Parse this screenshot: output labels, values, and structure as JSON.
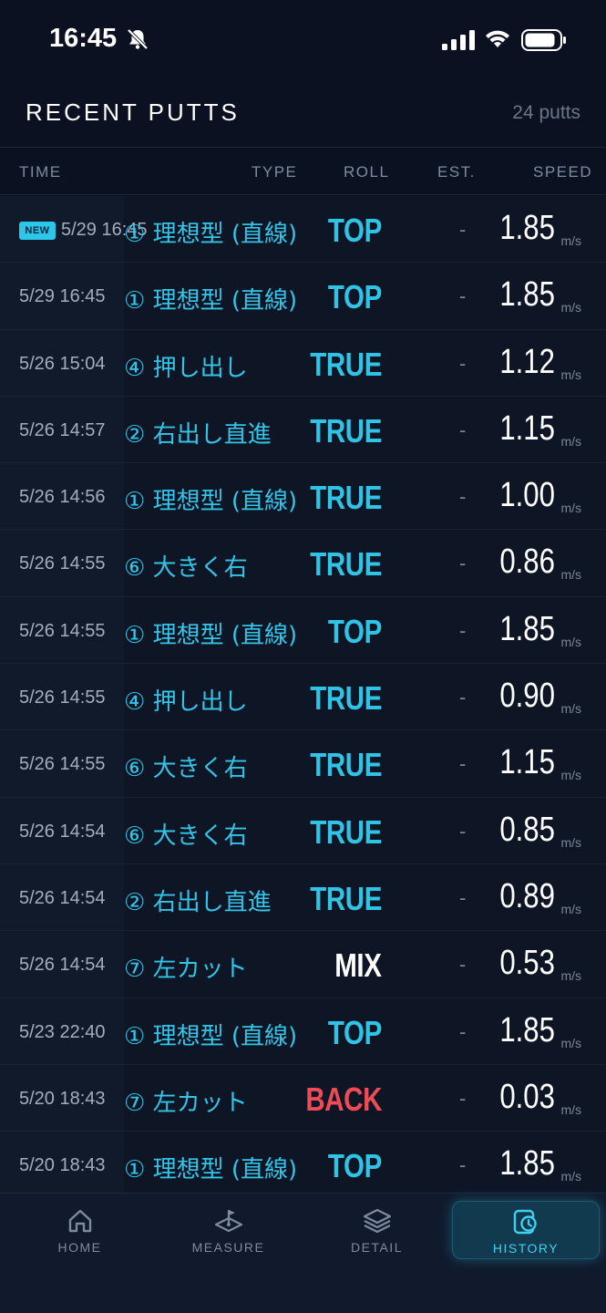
{
  "status_bar": {
    "time": "16:45"
  },
  "header": {
    "title": "RECENT PUTTS",
    "count": "24 putts"
  },
  "columns": {
    "time": "TIME",
    "type": "TYPE",
    "roll": "ROLL",
    "est": "EST.",
    "speed": "SPEED"
  },
  "new_badge": "NEW",
  "speed_unit": "m/s",
  "rows": [
    {
      "time": "5/29 16:45",
      "type": "① 理想型 (直線)",
      "roll": "TOP",
      "est": "-",
      "speed": "1.85",
      "is_new": true
    },
    {
      "time": "5/29 16:45",
      "type": "① 理想型 (直線)",
      "roll": "TOP",
      "est": "-",
      "speed": "1.85"
    },
    {
      "time": "5/26 15:04",
      "type": "④ 押し出し",
      "roll": "TRUE",
      "est": "-",
      "speed": "1.12"
    },
    {
      "time": "5/26 14:57",
      "type": "② 右出し直進",
      "roll": "TRUE",
      "est": "-",
      "speed": "1.15"
    },
    {
      "time": "5/26 14:56",
      "type": "① 理想型 (直線)",
      "roll": "TRUE",
      "est": "-",
      "speed": "1.00"
    },
    {
      "time": "5/26 14:55",
      "type": "⑥ 大きく右",
      "roll": "TRUE",
      "est": "-",
      "speed": "0.86"
    },
    {
      "time": "5/26 14:55",
      "type": "① 理想型 (直線)",
      "roll": "TOP",
      "est": "-",
      "speed": "1.85"
    },
    {
      "time": "5/26 14:55",
      "type": "④ 押し出し",
      "roll": "TRUE",
      "est": "-",
      "speed": "0.90"
    },
    {
      "time": "5/26 14:55",
      "type": "⑥ 大きく右",
      "roll": "TRUE",
      "est": "-",
      "speed": "1.15"
    },
    {
      "time": "5/26 14:54",
      "type": "⑥ 大きく右",
      "roll": "TRUE",
      "est": "-",
      "speed": "0.85"
    },
    {
      "time": "5/26 14:54",
      "type": "② 右出し直進",
      "roll": "TRUE",
      "est": "-",
      "speed": "0.89"
    },
    {
      "time": "5/26 14:54",
      "type": "⑦ 左カット",
      "roll": "MIX",
      "est": "-",
      "speed": "0.53"
    },
    {
      "time": "5/23 22:40",
      "type": "① 理想型 (直線)",
      "roll": "TOP",
      "est": "-",
      "speed": "1.85"
    },
    {
      "time": "5/20 18:43",
      "type": "⑦ 左カット",
      "roll": "BACK",
      "est": "-",
      "speed": "0.03"
    },
    {
      "time": "5/20 18:43",
      "type": "① 理想型 (直線)",
      "roll": "TOP",
      "est": "-",
      "speed": "1.85"
    }
  ],
  "roll_colors": {
    "TOP": "#2fc3e6",
    "TRUE": "#2fc3e6",
    "MIX": "#ffffff",
    "BACK": "#ef4b57"
  },
  "nav": {
    "home": {
      "label": "HOME",
      "icon": "home-icon"
    },
    "measure": {
      "label": "MEASURE",
      "icon": "measure-icon"
    },
    "detail": {
      "label": "DETAIL",
      "icon": "layers-icon"
    },
    "history": {
      "label": "HISTORY",
      "icon": "history-icon",
      "active": true
    }
  },
  "accent_color": "#2fc3e6"
}
